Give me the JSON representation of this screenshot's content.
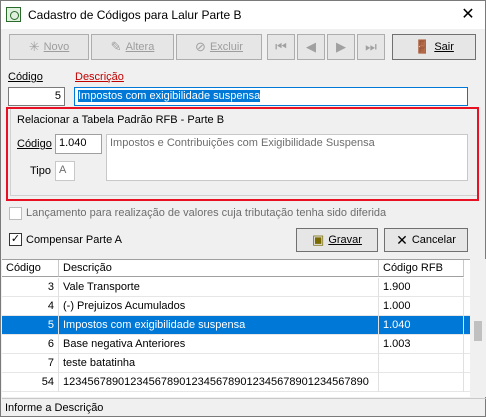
{
  "window": {
    "title": "Cadastro de Códigos para Lalur Parte B",
    "close_glyph": "✕"
  },
  "toolbar": {
    "novo": "Novo",
    "altera": "Altera",
    "exclui": "Excluir",
    "first": "⏮",
    "prev": "◀",
    "next": "▶",
    "last": "⏭",
    "sair": "Sair"
  },
  "form": {
    "codigo_label": "Código",
    "descricao_label": "Descrição",
    "codigo_value": "5",
    "descricao_value": "Impostos com exigibilidade suspensa"
  },
  "rfb_group": {
    "legend": "Relacionar a Tabela Padrão RFB - Parte B",
    "codigo_label": "Código",
    "codigo_value": "1.040",
    "tipo_label": "Tipo",
    "tipo_value": "A",
    "descricao_value": "Impostos e Contribuições com Exigibilidade Suspensa"
  },
  "options": {
    "lancamento_label": "Lançamento para realização de valores cuja tributação tenha sido diferida",
    "lancamento_checked": false,
    "compensar_label": "Compensar Parte A",
    "compensar_checked": true,
    "check_glyph": "✓"
  },
  "actions": {
    "gravar": "Gravar",
    "cancelar": "Cancelar",
    "cancel_glyph": "✕"
  },
  "grid": {
    "columns": [
      "Código",
      "Descrição",
      "Código RFB"
    ],
    "rows": [
      [
        "3",
        "Vale Transporte",
        "1.900"
      ],
      [
        "4",
        "(-) Prejuizos Acumulados",
        "1.000"
      ],
      [
        "5",
        "Impostos com exigibilidade suspensa",
        "1.040"
      ],
      [
        "6",
        "Base negativa Anteriores",
        "1.003"
      ],
      [
        "7",
        "teste batatinha",
        ""
      ],
      [
        "54",
        "12345678901234567890123456789012345678901234567890",
        ""
      ]
    ],
    "selected_index": 2
  },
  "status": {
    "text": "Informe a Descrição"
  },
  "colors": {
    "accent": "#0078d7",
    "highlight_border": "#e81123"
  }
}
